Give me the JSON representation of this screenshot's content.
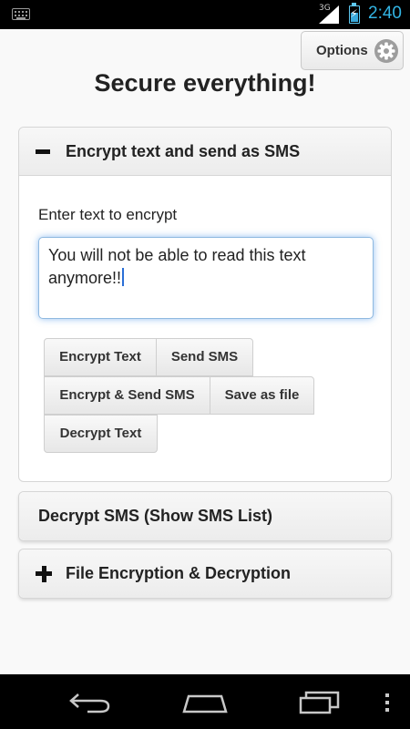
{
  "status_bar": {
    "network_type": "3G",
    "time": "2:40",
    "colors": {
      "accent": "#33b5e5",
      "background": "#000000"
    }
  },
  "header": {
    "options_label": "Options",
    "title": "Secure everything!"
  },
  "sections": {
    "encrypt": {
      "title": "Encrypt text and send as SMS",
      "expanded": true,
      "input_label": "Enter text to encrypt",
      "input_value": "You will not be able to read this text anymore!!",
      "buttons": {
        "encrypt_text": "Encrypt Text",
        "send_sms": "Send SMS",
        "encrypt_send": "Encrypt & Send SMS",
        "save_file": "Save as file",
        "decrypt_text": "Decrypt Text"
      }
    },
    "decrypt_sms": {
      "title": "Decrypt SMS (Show SMS List)"
    },
    "file": {
      "title": "File Encryption & Decryption",
      "expanded": false
    }
  },
  "navbar": {
    "icons": [
      "back-icon",
      "home-icon",
      "recent-apps-icon",
      "menu-icon"
    ]
  }
}
